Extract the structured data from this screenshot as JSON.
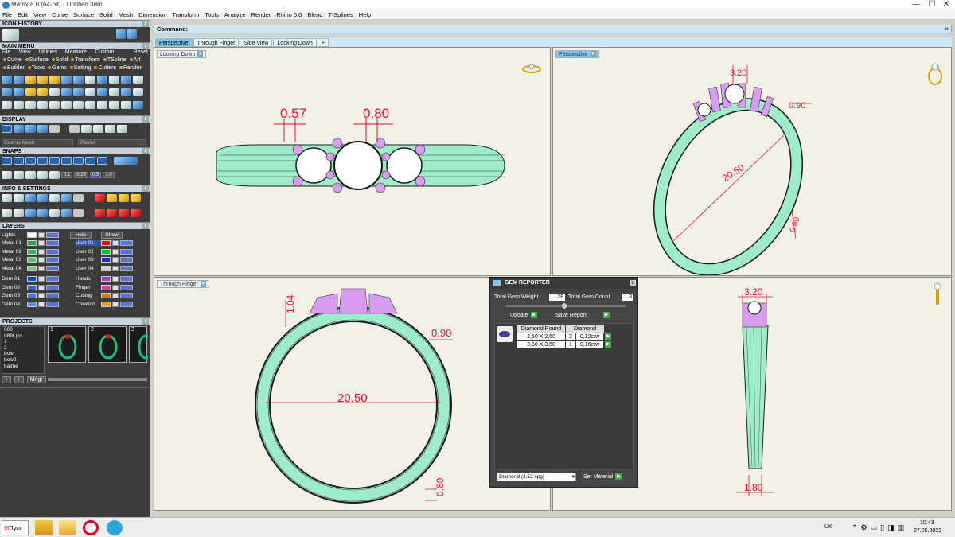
{
  "window": {
    "title": "Matrix 8.0 (64-bit) - Untitled.3dm",
    "min": "—",
    "max": "☐",
    "close": "✕"
  },
  "menubar": [
    "File",
    "Edit",
    "View",
    "Curve",
    "Surface",
    "Solid",
    "Mesh",
    "Dimension",
    "Transform",
    "Tools",
    "Analyze",
    "Render",
    "Rhino 5.0",
    "Blend",
    "T-Splines",
    "Help"
  ],
  "left": {
    "icon_history": "ICON HISTORY",
    "main_menu": "MAIN MENU",
    "main_menu_bar": [
      "File",
      "View",
      "Utilities",
      "Measure",
      "Custom",
      "Reset"
    ],
    "main_menu_row1": [
      "Curve",
      "Surface",
      "Solid",
      "Transform",
      "TSpline",
      "Art"
    ],
    "main_menu_row2": [
      "Builder",
      "Tools",
      "Gems",
      "Setting",
      "Cutters",
      "Render"
    ],
    "display": "DISPLAY",
    "display_mesh": "Coarse Mesh",
    "display_material": "Pastel",
    "snaps": "SNAPS",
    "snap_values": [
      "0.1",
      "0.25",
      "0.5",
      "1.0"
    ],
    "info": "INFO & SETTINGS",
    "layers": "LAYERS",
    "lights": "Lights",
    "hide": "Hide",
    "show": "Show",
    "layers_left": [
      {
        "name": "Metal 01",
        "color": "#2e9a4a"
      },
      {
        "name": "Metal 02",
        "color": "#27c24c"
      },
      {
        "name": "Metal 03",
        "color": "#3fd46a"
      },
      {
        "name": "Metal 04",
        "color": "#68d86a"
      },
      {
        "name": "Gem 01",
        "color": "#1b4fb8"
      },
      {
        "name": "Gem 02",
        "color": "#2a66d6"
      },
      {
        "name": "Gem 03",
        "color": "#3f7be2"
      },
      {
        "name": "Gem 04",
        "color": "#5a92ea"
      }
    ],
    "layers_right": [
      {
        "name": "User 01",
        "color": "#e01010"
      },
      {
        "name": "User 02",
        "color": "#10c020"
      },
      {
        "name": "User 03",
        "color": "#1030e0"
      },
      {
        "name": "User 04",
        "color": "#d0d0d0"
      },
      {
        "name": "Heads",
        "color": "#a040c0"
      },
      {
        "name": "Finger",
        "color": "#d040b0"
      },
      {
        "name": "Cutting",
        "color": "#e07010"
      },
      {
        "name": "Creation",
        "color": "#f0a010"
      }
    ],
    "projects": "PROJECTS",
    "project_files": [
      "000",
      "089Lprc",
      "1",
      "2",
      "bolv",
      "bolv2",
      "hajme"
    ],
    "thumb_nums": [
      "1",
      "2",
      "3"
    ],
    "mngr": "Mngr"
  },
  "command": {
    "label": "Command:"
  },
  "tabs": [
    "Perspective",
    "Through Finger",
    "Side View",
    "Looking Down",
    "+"
  ],
  "viewports": {
    "top_left": {
      "label": "Looking Down",
      "dims": [
        "0.57",
        "0.80"
      ]
    },
    "top_right": {
      "label": "Perspective",
      "dims": [
        "3.20",
        "0.90",
        "20.50",
        "0.80"
      ]
    },
    "bottom_left": {
      "label": "Through Finger",
      "dims": [
        "1.04",
        "0.90",
        "20.50",
        "0.80"
      ]
    },
    "bottom_right": {
      "dims": [
        "3.20",
        "1.80"
      ]
    }
  },
  "gem_reporter": {
    "title": "GEM REPORTER",
    "weight_label": "Total Gem Weight",
    "weight": ".28",
    "count_label": "Total Gem Count",
    "count": "3",
    "update": "Update",
    "save": "Save Report",
    "headers": [
      "Diamond Round",
      "Diamond"
    ],
    "rows": [
      {
        "size": "2,50 X 2,50",
        "qty": "2",
        "ct": "0,12ctw"
      },
      {
        "size": "3,50 X 3,50",
        "qty": "1",
        "ct": "0,16ctw"
      }
    ],
    "material": "Diamond     (3.52 spg)",
    "set_material": "Set Material",
    "plus": "+"
  },
  "taskbar": {
    "start": "Пуск",
    "lang": "UK",
    "time": "10:43",
    "date": "27.05.2022"
  }
}
